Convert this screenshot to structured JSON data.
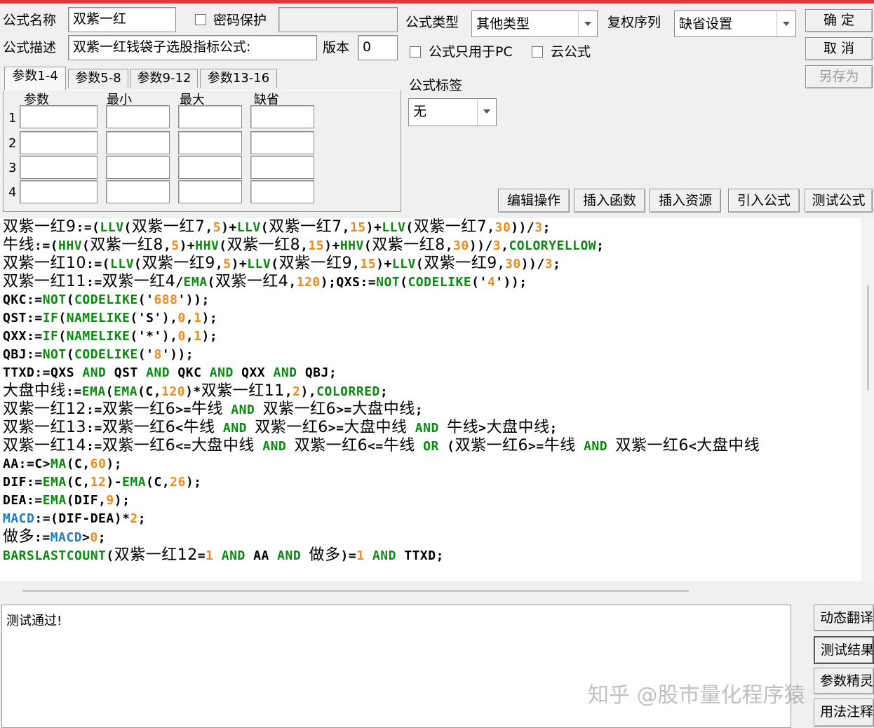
{
  "header": {
    "formula_name_label": "公式名称",
    "formula_name_value": "双紫一红",
    "password_label": "密码保护",
    "formula_type_label": "公式类型",
    "formula_type_value": "其他类型",
    "fq_label": "复权序列",
    "fq_value": "缺省设置",
    "desc_label": "公式描述",
    "desc_value": "双紫一红钱袋子选股指标公式:",
    "version_label": "版本",
    "version_value": "0",
    "pc_only_label": "公式只用于PC",
    "cloud_label": "云公式",
    "tag_label": "公式标签",
    "tag_value": "无"
  },
  "buttons": {
    "ok": "确  定",
    "cancel": "取  消",
    "save_as": "另存为",
    "edit_ops": "编辑操作",
    "insert_func": "插入函数",
    "insert_res": "插入资源",
    "import_formula": "引入公式",
    "test_formula": "测试公式"
  },
  "params": {
    "tabs": [
      "参数1-4",
      "参数5-8",
      "参数9-12",
      "参数13-16"
    ],
    "columns": [
      "参数",
      "最小",
      "最大",
      "缺省"
    ],
    "rows": [
      "1",
      "2",
      "3",
      "4"
    ]
  },
  "code_lines": [
    [
      [
        "t",
        "双紫一红9"
      ],
      [
        "p",
        ":=("
      ],
      [
        "f",
        "LLV"
      ],
      [
        "p",
        "("
      ],
      [
        "t",
        "双紫一红7"
      ],
      [
        "p",
        ","
      ],
      [
        "n",
        "5"
      ],
      [
        "p",
        ")+"
      ],
      [
        "f",
        "LLV"
      ],
      [
        "p",
        "("
      ],
      [
        "t",
        "双紫一红7"
      ],
      [
        "p",
        ","
      ],
      [
        "n",
        "15"
      ],
      [
        "p",
        ")+"
      ],
      [
        "f",
        "LLV"
      ],
      [
        "p",
        "("
      ],
      [
        "t",
        "双紫一红7"
      ],
      [
        "p",
        ","
      ],
      [
        "n",
        "30"
      ],
      [
        "p",
        "))/"
      ],
      [
        "n",
        "3"
      ],
      [
        "p",
        ";"
      ]
    ],
    [
      [
        "t",
        "牛线"
      ],
      [
        "p",
        ":=("
      ],
      [
        "f",
        "HHV"
      ],
      [
        "p",
        "("
      ],
      [
        "t",
        "双紫一红8"
      ],
      [
        "p",
        ","
      ],
      [
        "n",
        "5"
      ],
      [
        "p",
        ")+"
      ],
      [
        "f",
        "HHV"
      ],
      [
        "p",
        "("
      ],
      [
        "t",
        "双紫一红8"
      ],
      [
        "p",
        ","
      ],
      [
        "n",
        "15"
      ],
      [
        "p",
        ")+"
      ],
      [
        "f",
        "HHV"
      ],
      [
        "p",
        "("
      ],
      [
        "t",
        "双紫一红8"
      ],
      [
        "p",
        ","
      ],
      [
        "n",
        "30"
      ],
      [
        "p",
        "))/"
      ],
      [
        "n",
        "3"
      ],
      [
        "p",
        ","
      ],
      [
        "f",
        "COLORYELLOW"
      ],
      [
        "p",
        ";"
      ]
    ],
    [
      [
        "t",
        "双紫一红10"
      ],
      [
        "p",
        ":=("
      ],
      [
        "f",
        "LLV"
      ],
      [
        "p",
        "("
      ],
      [
        "t",
        "双紫一红9"
      ],
      [
        "p",
        ","
      ],
      [
        "n",
        "5"
      ],
      [
        "p",
        ")+"
      ],
      [
        "f",
        "LLV"
      ],
      [
        "p",
        "("
      ],
      [
        "t",
        "双紫一红9"
      ],
      [
        "p",
        ","
      ],
      [
        "n",
        "15"
      ],
      [
        "p",
        ")+"
      ],
      [
        "f",
        "LLV"
      ],
      [
        "p",
        "("
      ],
      [
        "t",
        "双紫一红9"
      ],
      [
        "p",
        ","
      ],
      [
        "n",
        "30"
      ],
      [
        "p",
        "))/"
      ],
      [
        "n",
        "3"
      ],
      [
        "p",
        ";"
      ]
    ],
    [
      [
        "t",
        "双紫一红11"
      ],
      [
        "p",
        ":="
      ],
      [
        "t",
        "双紫一红4"
      ],
      [
        "p",
        "/"
      ],
      [
        "f",
        "EMA"
      ],
      [
        "p",
        "("
      ],
      [
        "t",
        "双紫一红4"
      ],
      [
        "p",
        ","
      ],
      [
        "n",
        "120"
      ],
      [
        "p",
        ");QXS:="
      ],
      [
        "f",
        "NOT"
      ],
      [
        "p",
        "("
      ],
      [
        "f",
        "CODELIKE"
      ],
      [
        "p",
        "('"
      ],
      [
        "n",
        "4"
      ],
      [
        "p",
        "'));"
      ]
    ],
    [
      [
        "p",
        "QKC:="
      ],
      [
        "f",
        "NOT"
      ],
      [
        "p",
        "("
      ],
      [
        "f",
        "CODELIKE"
      ],
      [
        "p",
        "('"
      ],
      [
        "n",
        "688"
      ],
      [
        "p",
        "'));"
      ]
    ],
    [
      [
        "p",
        "QST:="
      ],
      [
        "f",
        "IF"
      ],
      [
        "p",
        "("
      ],
      [
        "f",
        "NAMELIKE"
      ],
      [
        "p",
        "('S'),"
      ],
      [
        "n",
        "0"
      ],
      [
        "p",
        ","
      ],
      [
        "n",
        "1"
      ],
      [
        "p",
        ");"
      ]
    ],
    [
      [
        "p",
        "QXX:="
      ],
      [
        "f",
        "IF"
      ],
      [
        "p",
        "("
      ],
      [
        "f",
        "NAMELIKE"
      ],
      [
        "p",
        "('*'),"
      ],
      [
        "n",
        "0"
      ],
      [
        "p",
        ","
      ],
      [
        "n",
        "1"
      ],
      [
        "p",
        ");"
      ]
    ],
    [
      [
        "p",
        "QBJ:="
      ],
      [
        "f",
        "NOT"
      ],
      [
        "p",
        "("
      ],
      [
        "f",
        "CODELIKE"
      ],
      [
        "p",
        "('"
      ],
      [
        "n",
        "8"
      ],
      [
        "p",
        "'));"
      ]
    ],
    [
      [
        "p",
        "TTXD:=QXS "
      ],
      [
        "f",
        "AND"
      ],
      [
        "p",
        " QST "
      ],
      [
        "f",
        "AND"
      ],
      [
        "p",
        " QKC "
      ],
      [
        "f",
        "AND"
      ],
      [
        "p",
        " QXX "
      ],
      [
        "f",
        "AND"
      ],
      [
        "p",
        " QBJ;"
      ]
    ],
    [
      [
        "t",
        "大盘中线"
      ],
      [
        "p",
        ":="
      ],
      [
        "f",
        "EMA"
      ],
      [
        "p",
        "("
      ],
      [
        "f",
        "EMA"
      ],
      [
        "p",
        "(C,"
      ],
      [
        "n",
        "120"
      ],
      [
        "p",
        ")*"
      ],
      [
        "t",
        "双紫一红11"
      ],
      [
        "p",
        ","
      ],
      [
        "n",
        "2"
      ],
      [
        "p",
        "),"
      ],
      [
        "f",
        "COLORRED"
      ],
      [
        "p",
        ";"
      ]
    ],
    [
      [
        "t",
        "双紫一红12"
      ],
      [
        "p",
        ":="
      ],
      [
        "t",
        "双紫一红6"
      ],
      [
        "p",
        ">="
      ],
      [
        "t",
        "牛线"
      ],
      [
        "p",
        " "
      ],
      [
        "f",
        "AND"
      ],
      [
        "p",
        " "
      ],
      [
        "t",
        "双紫一红6"
      ],
      [
        "p",
        ">="
      ],
      [
        "t",
        "大盘中线"
      ],
      [
        "p",
        ";"
      ]
    ],
    [
      [
        "t",
        "双紫一红13"
      ],
      [
        "p",
        ":="
      ],
      [
        "t",
        "双紫一红6"
      ],
      [
        "p",
        "<"
      ],
      [
        "t",
        "牛线"
      ],
      [
        "p",
        " "
      ],
      [
        "f",
        "AND"
      ],
      [
        "p",
        " "
      ],
      [
        "t",
        "双紫一红6"
      ],
      [
        "p",
        ">="
      ],
      [
        "t",
        "大盘中线"
      ],
      [
        "p",
        " "
      ],
      [
        "f",
        "AND"
      ],
      [
        "p",
        " "
      ],
      [
        "t",
        "牛线"
      ],
      [
        "p",
        ">"
      ],
      [
        "t",
        "大盘中线"
      ],
      [
        "p",
        ";"
      ]
    ],
    [
      [
        "t",
        "双紫一红14"
      ],
      [
        "p",
        ":="
      ],
      [
        "t",
        "双紫一红6"
      ],
      [
        "p",
        "<="
      ],
      [
        "t",
        "大盘中线"
      ],
      [
        "p",
        " "
      ],
      [
        "f",
        "AND"
      ],
      [
        "p",
        " "
      ],
      [
        "t",
        "双紫一红6"
      ],
      [
        "p",
        "<="
      ],
      [
        "t",
        "牛线"
      ],
      [
        "p",
        " "
      ],
      [
        "f",
        "OR"
      ],
      [
        "p",
        " ("
      ],
      [
        "t",
        "双紫一红6"
      ],
      [
        "p",
        ">="
      ],
      [
        "t",
        "牛线"
      ],
      [
        "p",
        " "
      ],
      [
        "f",
        "AND"
      ],
      [
        "p",
        " "
      ],
      [
        "t",
        "双紫一红6"
      ],
      [
        "p",
        "<"
      ],
      [
        "t",
        "大盘中线"
      ]
    ],
    [
      [
        "p",
        "AA:=C>"
      ],
      [
        "f",
        "MA"
      ],
      [
        "p",
        "(C,"
      ],
      [
        "n",
        "60"
      ],
      [
        "p",
        ");"
      ]
    ],
    [
      [
        "p",
        "DIF:="
      ],
      [
        "f",
        "EMA"
      ],
      [
        "p",
        "(C,"
      ],
      [
        "n",
        "12"
      ],
      [
        "p",
        ")-"
      ],
      [
        "f",
        "EMA"
      ],
      [
        "p",
        "(C,"
      ],
      [
        "n",
        "26"
      ],
      [
        "p",
        ");"
      ]
    ],
    [
      [
        "p",
        "DEA:="
      ],
      [
        "f",
        "EMA"
      ],
      [
        "p",
        "(DIF,"
      ],
      [
        "n",
        "9"
      ],
      [
        "p",
        ");"
      ]
    ],
    [
      [
        "b",
        "MACD"
      ],
      [
        "p",
        ":=(DIF-DEA)*"
      ],
      [
        "n",
        "2"
      ],
      [
        "p",
        ";"
      ]
    ],
    [
      [
        "t",
        "做多"
      ],
      [
        "p",
        ":="
      ],
      [
        "b",
        "MACD"
      ],
      [
        "p",
        ">"
      ],
      [
        "n",
        "0"
      ],
      [
        "p",
        ";"
      ]
    ],
    [
      [
        "f",
        "BARSLASTCOUNT"
      ],
      [
        "p",
        "("
      ],
      [
        "t",
        "双紫一红12"
      ],
      [
        "p",
        "="
      ],
      [
        "n",
        "1"
      ],
      [
        "p",
        " "
      ],
      [
        "f",
        "AND"
      ],
      [
        "p",
        " AA "
      ],
      [
        "f",
        "AND"
      ],
      [
        "p",
        " "
      ],
      [
        "t",
        "做多"
      ],
      [
        "p",
        ")="
      ],
      [
        "n",
        "1"
      ],
      [
        "p",
        " "
      ],
      [
        "f",
        "AND"
      ],
      [
        "p",
        " TTXD;"
      ]
    ]
  ],
  "output": {
    "text": "测试通过!",
    "side_buttons": [
      "动态翻译",
      "测试结果",
      "参数精灵",
      "用法注释"
    ]
  },
  "watermark": "知乎 @股市量化程序猿"
}
